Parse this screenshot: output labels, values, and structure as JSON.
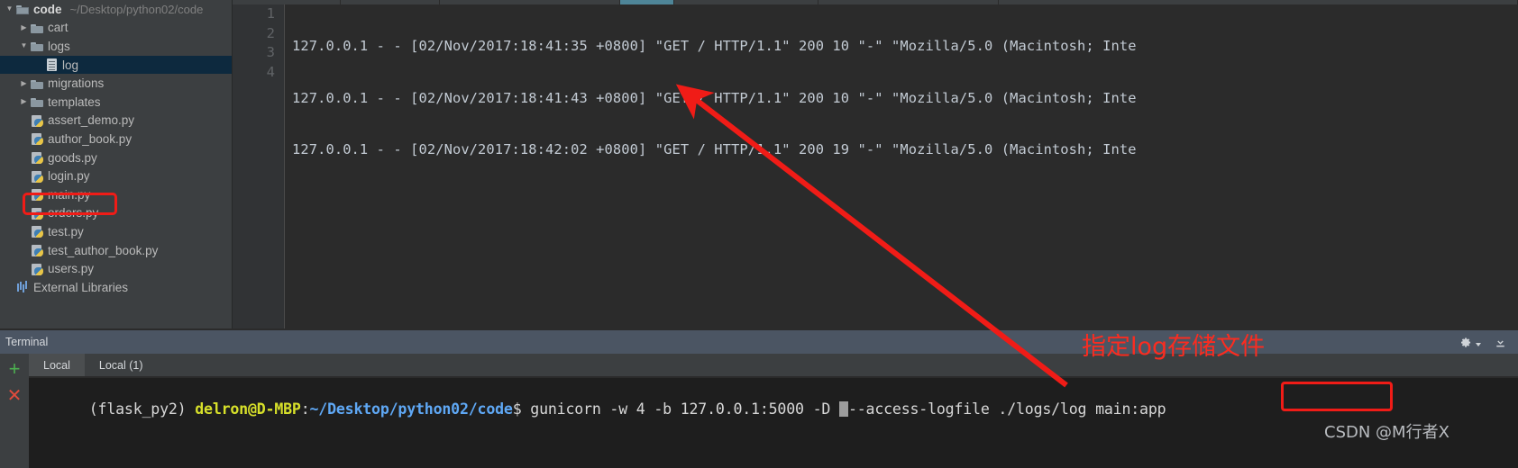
{
  "window": {
    "editor_tabs_note": "partially visible tab strip"
  },
  "sidebar": {
    "project_root": {
      "name": "code",
      "path": "~/Desktop/python02/code"
    },
    "items": [
      {
        "label": "cart",
        "type": "folder",
        "depth": 1,
        "arrow": "▶",
        "selected": false
      },
      {
        "label": "logs",
        "type": "folder",
        "depth": 1,
        "arrow": "▼",
        "selected": false
      },
      {
        "label": "log",
        "type": "file",
        "depth": 2,
        "arrow": "",
        "selected": true
      },
      {
        "label": "migrations",
        "type": "folder",
        "depth": 1,
        "arrow": "▶",
        "selected": false
      },
      {
        "label": "templates",
        "type": "folder",
        "depth": 1,
        "arrow": "▶",
        "selected": false
      },
      {
        "label": "assert_demo.py",
        "type": "py",
        "depth": 1,
        "arrow": "",
        "selected": false
      },
      {
        "label": "author_book.py",
        "type": "py",
        "depth": 1,
        "arrow": "",
        "selected": false
      },
      {
        "label": "goods.py",
        "type": "py",
        "depth": 1,
        "arrow": "",
        "selected": false
      },
      {
        "label": "login.py",
        "type": "py",
        "depth": 1,
        "arrow": "",
        "selected": false
      },
      {
        "label": "main.py",
        "type": "py",
        "depth": 1,
        "arrow": "",
        "selected": false
      },
      {
        "label": "orders.py",
        "type": "py",
        "depth": 1,
        "arrow": "",
        "selected": false
      },
      {
        "label": "test.py",
        "type": "py",
        "depth": 1,
        "arrow": "",
        "selected": false
      },
      {
        "label": "test_author_book.py",
        "type": "py",
        "depth": 1,
        "arrow": "",
        "selected": false
      },
      {
        "label": "users.py",
        "type": "py",
        "depth": 1,
        "arrow": "",
        "selected": false
      },
      {
        "label": "External Libraries",
        "type": "lib",
        "depth": 0,
        "arrow": "",
        "selected": false
      }
    ]
  },
  "editor": {
    "line_numbers": [
      "1",
      "2",
      "3",
      "4"
    ],
    "lines": [
      "127.0.0.1 - - [02/Nov/2017:18:41:35 +0800] \"GET / HTTP/1.1\" 200 10 \"-\" \"Mozilla/5.0 (Macintosh; Inte",
      "127.0.0.1 - - [02/Nov/2017:18:41:43 +0800] \"GET / HTTP/1.1\" 200 10 \"-\" \"Mozilla/5.0 (Macintosh; Inte",
      "127.0.0.1 - - [02/Nov/2017:18:42:02 +0800] \"GET / HTTP/1.1\" 200 19 \"-\" \"Mozilla/5.0 (Macintosh; Inte",
      ""
    ]
  },
  "terminal": {
    "title": "Terminal",
    "tabs": [
      {
        "label": "Local",
        "active": true
      },
      {
        "label": "Local (1)",
        "active": false
      }
    ],
    "new_tab_icon": "plus-icon",
    "close_tab_icon": "close-icon",
    "settings_icon": "gear-icon",
    "hide_icon": "hide-panel-icon",
    "prompt": {
      "venv": "(flask_py2) ",
      "user_host": "delron@D-MBP",
      "colon": ":",
      "path": "~/Desktop/python02/code",
      "dollar": "$ "
    },
    "command_before_cursor": "gunicorn -w 4 -b 127.0.0.1:5000 -D ",
    "command_after_cursor": "--access-logfile ./logs/log main:app"
  },
  "annotations": {
    "note_text": "指定log存储文件",
    "note_color": "#fb2c20",
    "highlight_color": "#f01c17",
    "highlighted_file": "main.py",
    "highlighted_arg": "main:app",
    "watermark": "CSDN @M行者X"
  }
}
